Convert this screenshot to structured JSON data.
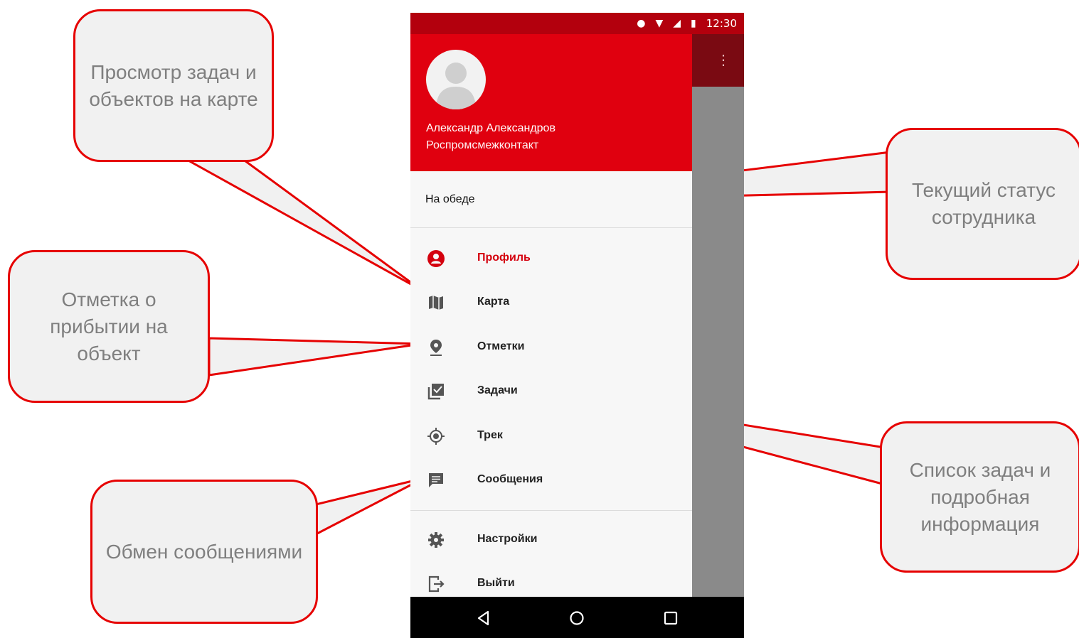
{
  "status_bar": {
    "time": "12:30"
  },
  "profile": {
    "name": "Александр Александров",
    "company": "Роспромсмежконтакт"
  },
  "status": {
    "text": "На обеде"
  },
  "menu": [
    {
      "label": "Профиль",
      "icon": "account-circle-icon",
      "active": true
    },
    {
      "label": "Карта",
      "icon": "map-icon"
    },
    {
      "label": "Отметки",
      "icon": "place-icon"
    },
    {
      "label": "Задачи",
      "icon": "tasks-icon"
    },
    {
      "label": "Трек",
      "icon": "gps-track-icon"
    },
    {
      "label": "Сообщения",
      "icon": "message-icon"
    },
    {
      "label": "Настройки",
      "icon": "gear-icon"
    },
    {
      "label": "Выйти",
      "icon": "logout-icon"
    }
  ],
  "callouts": {
    "map_view": "Просмотр задач и объектов на карте",
    "current_status": "Текущий статус сотрудника",
    "arrival_mark": "Отметка о прибытии на объект",
    "tasks_list": "Список задач и подробная информация",
    "messaging": "Обмен сообщениями"
  },
  "colors": {
    "header_red": "#e0000f",
    "status_bar_red": "#b3000d",
    "accent": "#d4000e",
    "callout_border": "#e60000",
    "callout_fill": "#f1f1f1",
    "callout_text": "#7f7f7f"
  }
}
